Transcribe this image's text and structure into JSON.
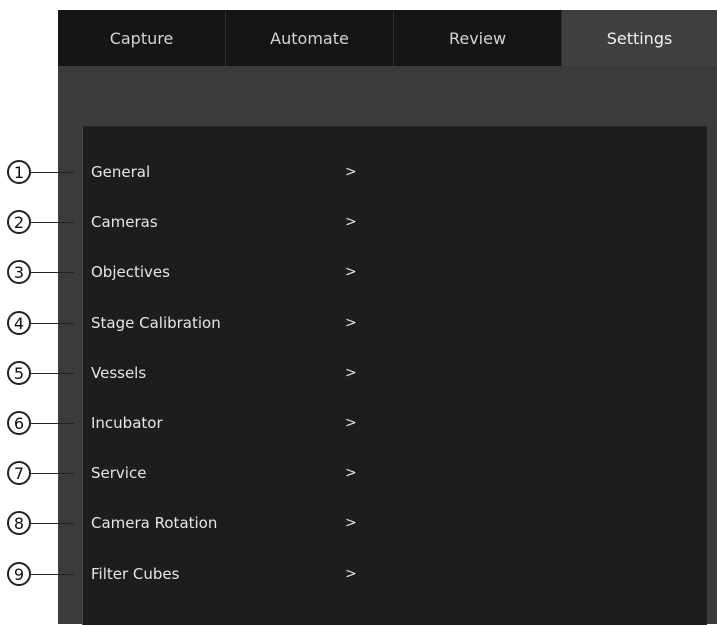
{
  "tabs": [
    {
      "label": "Capture"
    },
    {
      "label": "Automate"
    },
    {
      "label": "Review"
    },
    {
      "label": "Settings",
      "active": true
    }
  ],
  "settings_menu": {
    "arrow_glyph": ">",
    "items": [
      {
        "label": "General"
      },
      {
        "label": "Cameras"
      },
      {
        "label": "Objectives"
      },
      {
        "label": "Stage Calibration"
      },
      {
        "label": "Vessels"
      },
      {
        "label": "Incubator"
      },
      {
        "label": "Service"
      },
      {
        "label": "Camera Rotation"
      },
      {
        "label": "Filter Cubes"
      }
    ]
  },
  "callouts": [
    "1",
    "2",
    "3",
    "4",
    "5",
    "6",
    "7",
    "8",
    "9"
  ],
  "colors": {
    "tab_bar": "#151515",
    "active_tab": "#404040",
    "app_background": "#3b3b3b",
    "panel_background": "#1d1d1d",
    "text": "#e6e6e6"
  }
}
